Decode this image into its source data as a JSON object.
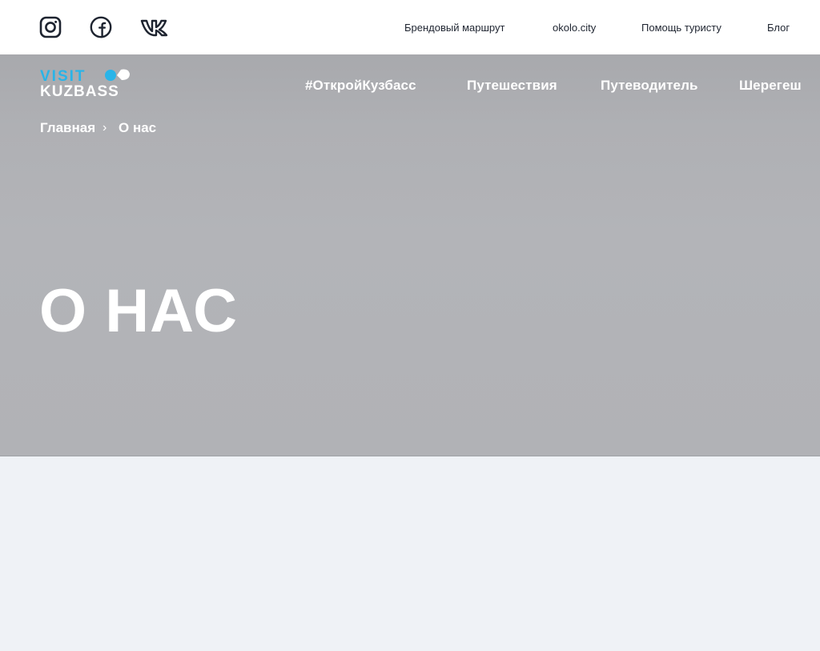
{
  "topbar": {
    "social": [
      {
        "name": "instagram-icon"
      },
      {
        "name": "facebook-icon"
      },
      {
        "name": "vk-icon"
      }
    ],
    "links": [
      "Брендовый маршрут",
      "okolo.city",
      "Помощь туристу",
      "Блог"
    ]
  },
  "header": {
    "logo": {
      "line1": "VISIT",
      "line2": "KUZBASS"
    },
    "nav": [
      "#ОткройКузбасс",
      "Путешествия",
      "Путеводитель",
      "Шерегеш"
    ]
  },
  "breadcrumb": {
    "home": "Главная",
    "separator": "›",
    "current": "О нас"
  },
  "hero": {
    "title": "О НАС"
  },
  "colors": {
    "accent": "#29b4e8",
    "hero_bg": "#b2b3b7",
    "page_bg": "#eff2f6",
    "topbar_text": "#1e2430"
  }
}
